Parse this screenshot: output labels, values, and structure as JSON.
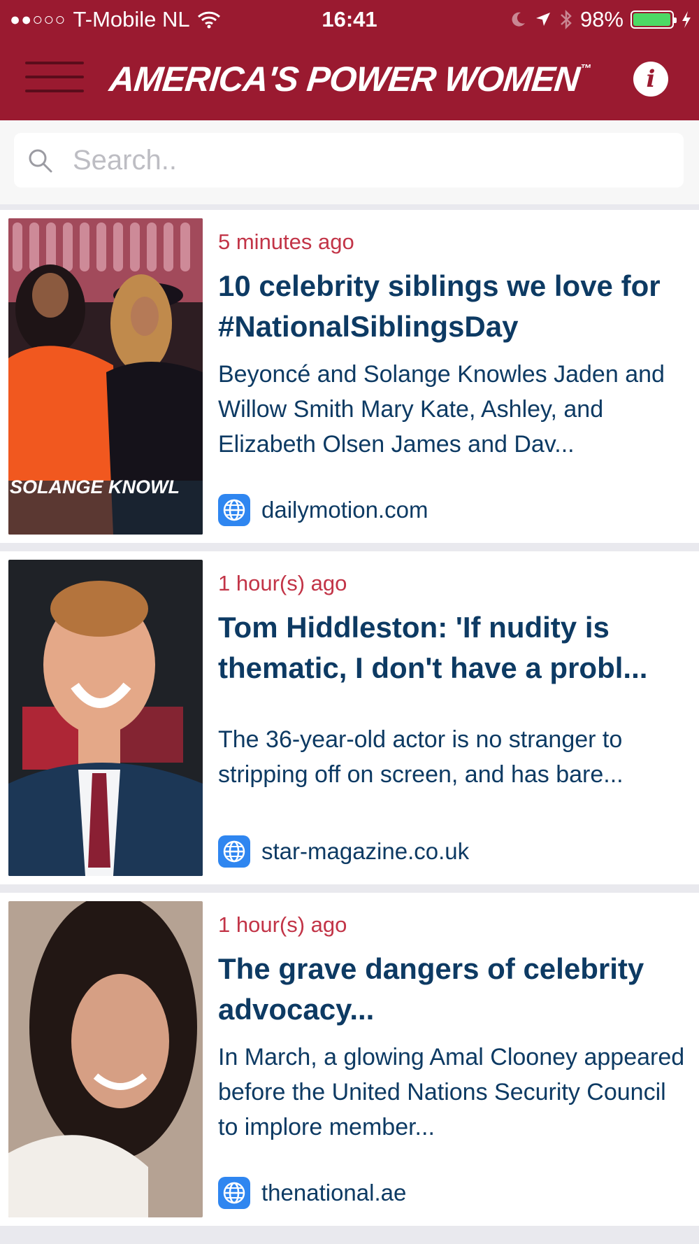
{
  "status_bar": {
    "signal": "●●○○○",
    "carrier": "T-Mobile NL",
    "time": "16:41",
    "battery_percent": "98%",
    "battery_level": 0.98,
    "icons": [
      "wifi-icon",
      "moon-icon",
      "location-arrow-icon",
      "bluetooth-icon",
      "battery-icon",
      "charging-bolt-icon"
    ]
  },
  "header": {
    "title": "America's Power Women",
    "trademark": "™",
    "info_label": "i",
    "background_color": "#9a1a30",
    "icons": [
      "hamburger-menu-icon",
      "info-icon"
    ]
  },
  "search": {
    "placeholder": "Search.."
  },
  "articles": [
    {
      "time": "5 minutes ago",
      "title": "10 celebrity siblings we love for #NationalSiblingsDay",
      "description": "Beyoncé and Solange Knowles Jaden and Willow Smith Mary Kate, Ashley, and Elizabeth Olsen James and Dav...",
      "source": "dailymotion.com",
      "image_caption": "SOLANGE KNOWL"
    },
    {
      "time": "1 hour(s) ago",
      "title": "Tom Hiddleston: 'If nudity is thematic, I don't have a probl...",
      "description": "The 36-year-old actor is no stranger to stripping off on screen, and has bare...",
      "source": "star-magazine.co.uk",
      "image_caption": ""
    },
    {
      "time": "1 hour(s) ago",
      "title": "The grave dangers of celebrity advocacy...",
      "description": "In March, a glowing Amal Clooney appeared before the United Nations Security Council to implore member...",
      "source": "thenational.ae",
      "image_caption": ""
    }
  ],
  "colors": {
    "accent": "#c23447",
    "text": "#0d3a63",
    "link_icon": "#2f86f0"
  }
}
